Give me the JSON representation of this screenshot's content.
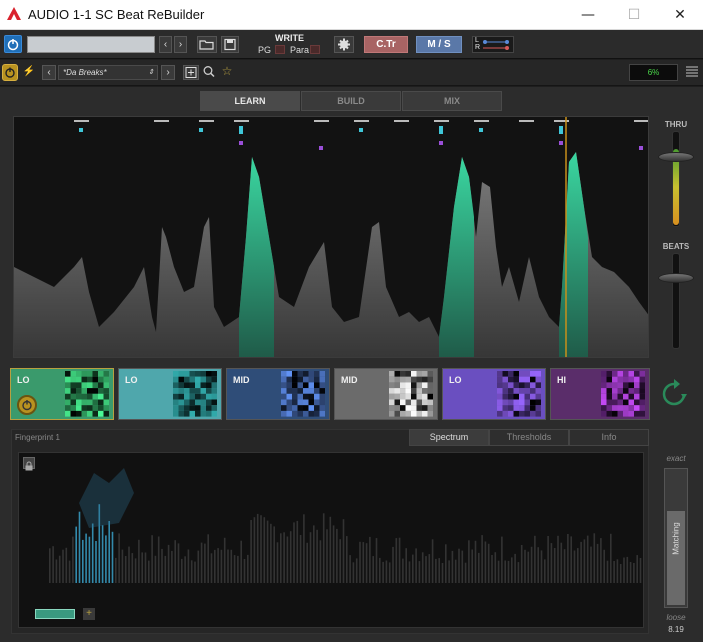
{
  "window": {
    "title": "AUDIO 1-1 SC Beat ReBuilder",
    "minimize": "—",
    "maximize": "☐",
    "close": "✕"
  },
  "toolbar1": {
    "write_label": "WRITE",
    "pg_label": "PG",
    "para_label": "Para",
    "ctr_label": "C.Tr",
    "ms_label": "M / S",
    "l_label": "L",
    "r_label": "R"
  },
  "toolbar2": {
    "preset": "*Da Breaks*",
    "cpu": "6%"
  },
  "tabs": [
    "LEARN",
    "BUILD",
    "MIX"
  ],
  "active_tab": "LEARN",
  "bands": [
    {
      "label": "LO",
      "color": "#3a9a6c",
      "text_color": "#f0f0f0"
    },
    {
      "label": "LO",
      "color": "#4fa7ac",
      "text_color": "#f0f0f0"
    },
    {
      "label": "MID",
      "color": "#2f4d78",
      "text_color": "#f0f0f0"
    },
    {
      "label": "MID",
      "color": "#6b6b6b",
      "text_color": "#f0f0f0"
    },
    {
      "label": "LO",
      "color": "#6a4fc0",
      "text_color": "#f0f0f0"
    },
    {
      "label": "HI",
      "color": "#5a2d6a",
      "text_color": "#f0f0f0"
    }
  ],
  "lower": {
    "fingerprint": "Fingerprint 1",
    "tabs": [
      "Spectrum",
      "Thresholds",
      "Info"
    ],
    "active_tab": "Spectrum"
  },
  "side": {
    "thru": "THRU",
    "beats": "BEATS",
    "exact": "exact",
    "loose": "loose",
    "matching": "Matching",
    "value": "8.19"
  },
  "colors": {
    "accent_teal": "#3ad6a0",
    "marker_cyan": "#3fc6d8",
    "marker_purple": "#9a4fd8",
    "playhead": "#c8901a"
  }
}
